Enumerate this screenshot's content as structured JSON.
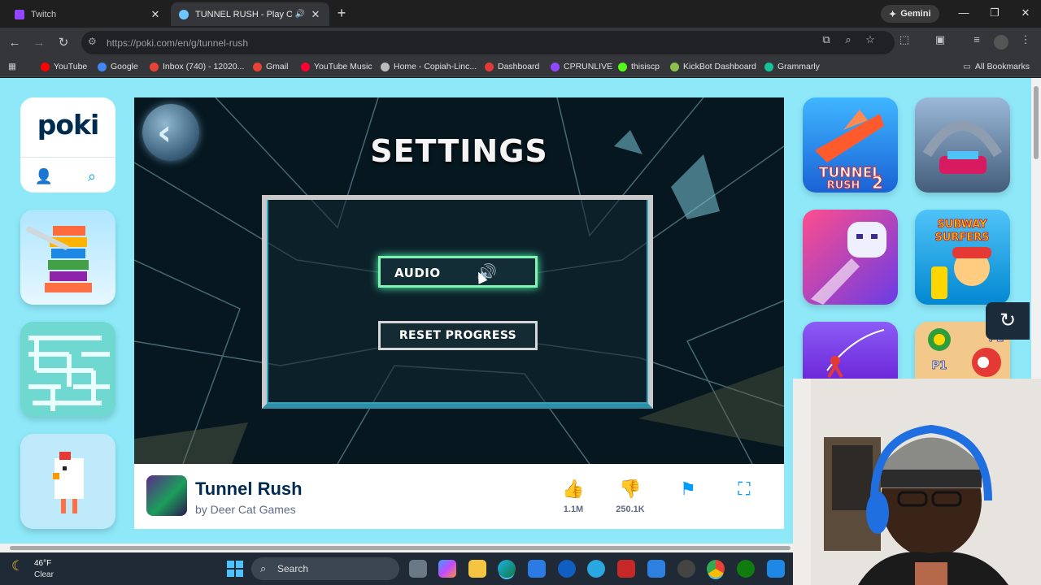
{
  "browser": {
    "tabs": [
      {
        "title": "Twitch",
        "active": false,
        "close": "✕"
      },
      {
        "title": "TUNNEL RUSH - Play Online",
        "active": true,
        "close": "✕"
      }
    ],
    "new_tab": "+",
    "gemini_label": "Gemini",
    "window_controls": [
      "—",
      "❐",
      "✕"
    ],
    "url": "https://poki.com/en/g/tunnel-rush",
    "bookmarks": [
      {
        "label": "YouTube",
        "color": "#ff0000"
      },
      {
        "label": "Google",
        "color": "#4285f4"
      },
      {
        "label": "Inbox (740) - 12020...",
        "color": "#ea4335"
      },
      {
        "label": "Gmail",
        "color": "#ea4335"
      },
      {
        "label": "YouTube Music",
        "color": "#ff0033"
      },
      {
        "label": "Home - Copiah-Linc...",
        "color": "#bbbbbb"
      },
      {
        "label": "Dashboard",
        "color": "#e53935"
      },
      {
        "label": "CPRUNLIVE",
        "color": "#9146ff"
      },
      {
        "label": "thisiscp",
        "color": "#53fc18"
      },
      {
        "label": "KickBot Dashboard",
        "color": "#8bc34a"
      },
      {
        "label": "Grammarly",
        "color": "#15c39a"
      }
    ],
    "all_bookmarks": "All Bookmarks"
  },
  "poki": {
    "logo": "poki",
    "game": {
      "settings_title": "SETTINGS",
      "audio_label": "AUDIO",
      "reset_label": "RESET PROGRESS"
    },
    "info": {
      "title": "Tunnel Rush",
      "developer": "by Deer Cat Games",
      "likes": "1.1M",
      "dislikes": "250.1K"
    },
    "tiles_left": [
      "stack-knife-game",
      "maze-game",
      "crossy-chicken-game"
    ],
    "tiles_right": [
      "Tunnel Rush 2",
      "car-stunt-game",
      "ghost-dash-game",
      "Subway Surfers",
      "stickman-swing-game",
      "P1 vs P2 flags game"
    ]
  },
  "taskbar": {
    "temp": "46°F",
    "condition": "Clear",
    "search_label": "Search"
  }
}
